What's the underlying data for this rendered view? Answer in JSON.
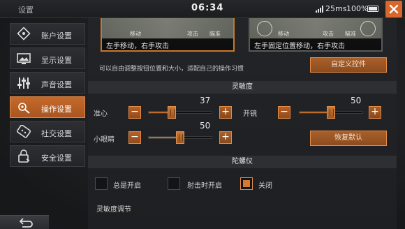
{
  "topbar": {
    "title": "设置",
    "clock": "06:34",
    "ping": "25ms",
    "battery": "100%"
  },
  "sidebar": {
    "items": [
      {
        "label": "账户设置",
        "icon": "account-icon"
      },
      {
        "label": "显示设置",
        "icon": "display-icon"
      },
      {
        "label": "声音设置",
        "icon": "sound-icon"
      },
      {
        "label": "操作设置",
        "icon": "controls-icon",
        "active": true
      },
      {
        "label": "社交设置",
        "icon": "social-icon"
      },
      {
        "label": "安全设置",
        "icon": "security-icon"
      }
    ]
  },
  "previews": [
    {
      "caption": "左手移动，右手攻击",
      "move": "移动",
      "attack": "攻击",
      "aim": "瞄准"
    },
    {
      "caption": "左手固定位置移动，右手攻击",
      "move": "移动",
      "attack": "攻击",
      "aim": "瞄准"
    }
  ],
  "hint": "可以自由调整按钮位置和大小，适配自己的操作习惯",
  "custom_controls_label": "自定义控件",
  "sensitivity": {
    "header": "灵敏度",
    "crosshair": {
      "label": "准心",
      "value": "37",
      "fraction": 0.37
    },
    "scope": {
      "label": "开镜",
      "value": "50",
      "fraction": 0.5
    },
    "camera": {
      "label": "小眼睛",
      "value": "50",
      "fraction": 0.5
    },
    "minus": "−",
    "plus": "+",
    "reset_label": "恢复默认"
  },
  "gyroscope": {
    "header": "陀螺仪",
    "options": [
      {
        "label": "总是开启",
        "checked": false
      },
      {
        "label": "射击时开启",
        "checked": false
      },
      {
        "label": "关闭",
        "checked": true
      }
    ],
    "sub_header": "灵敏度调节"
  },
  "colors": {
    "accent": "#d9662a",
    "active_tab": "#c56a2c"
  }
}
